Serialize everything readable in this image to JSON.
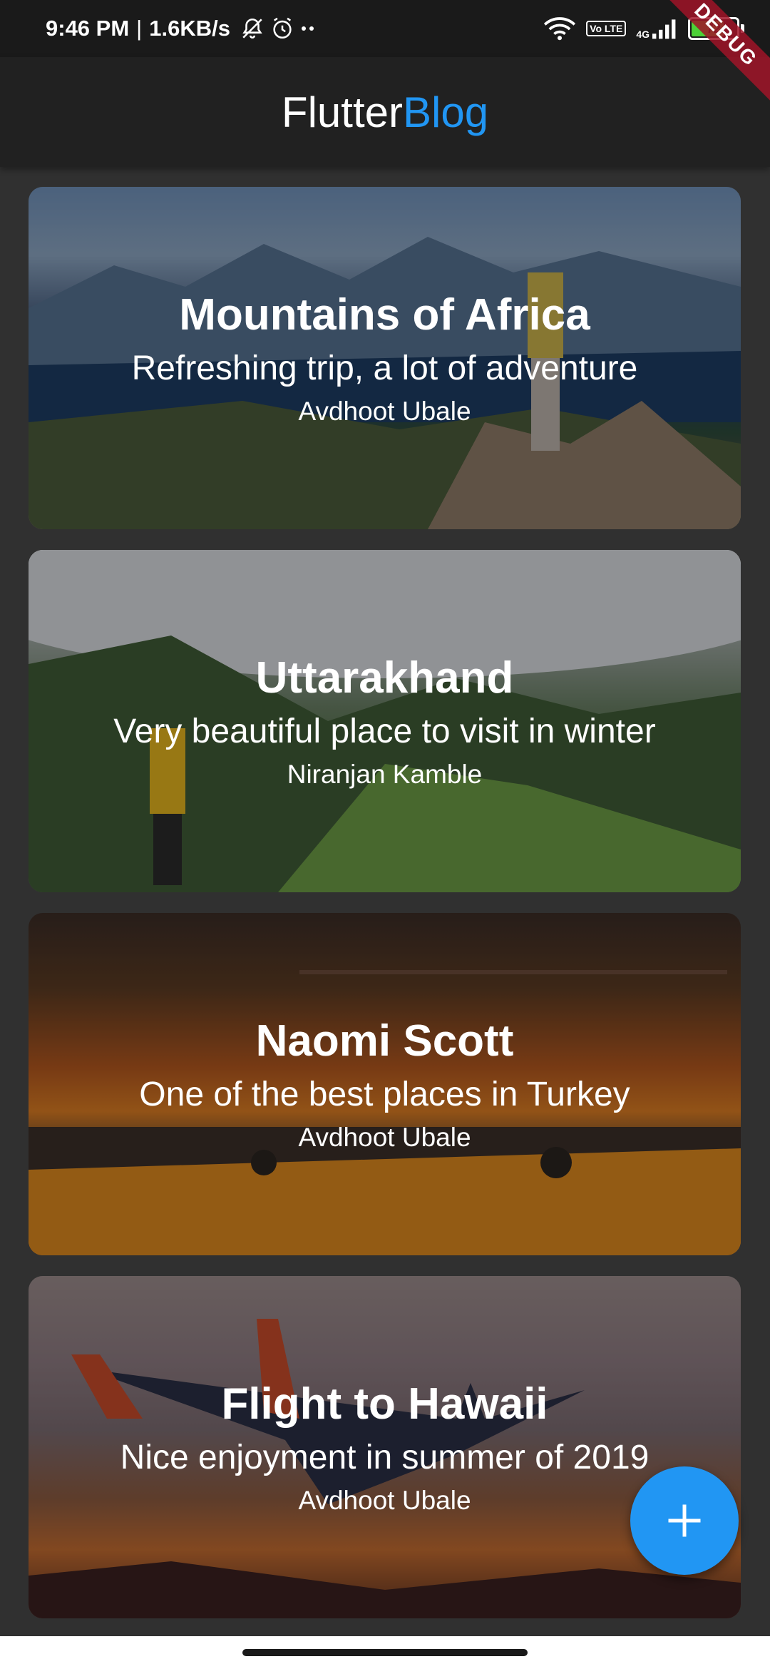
{
  "status_bar": {
    "time": "9:46 PM",
    "separator": "|",
    "net_speed": "1.6KB/s",
    "vo_lte": "Vo LTE",
    "network": "4G",
    "battery_level": "72",
    "battery_fraction": 0.72
  },
  "debug_banner": "DEBUG",
  "app_bar": {
    "title_part1": "Flutter",
    "title_part2": "Blog",
    "accent_color": "#2196f3"
  },
  "posts": [
    {
      "title": "Mountains of Africa",
      "description": "Refreshing trip, a lot of adventure",
      "author": "Avdhoot Ubale"
    },
    {
      "title": "Uttarakhand",
      "description": "Very beautiful place to visit in winter",
      "author": "Niranjan Kamble"
    },
    {
      "title": "Naomi Scott",
      "description": "One of the best places in Turkey",
      "author": "Avdhoot Ubale"
    },
    {
      "title": "Flight to Hawaii",
      "description": "Nice enjoyment in summer of 2019",
      "author": "Avdhoot Ubale"
    }
  ],
  "fab": {
    "icon": "plus-icon",
    "color": "#2196f3"
  }
}
